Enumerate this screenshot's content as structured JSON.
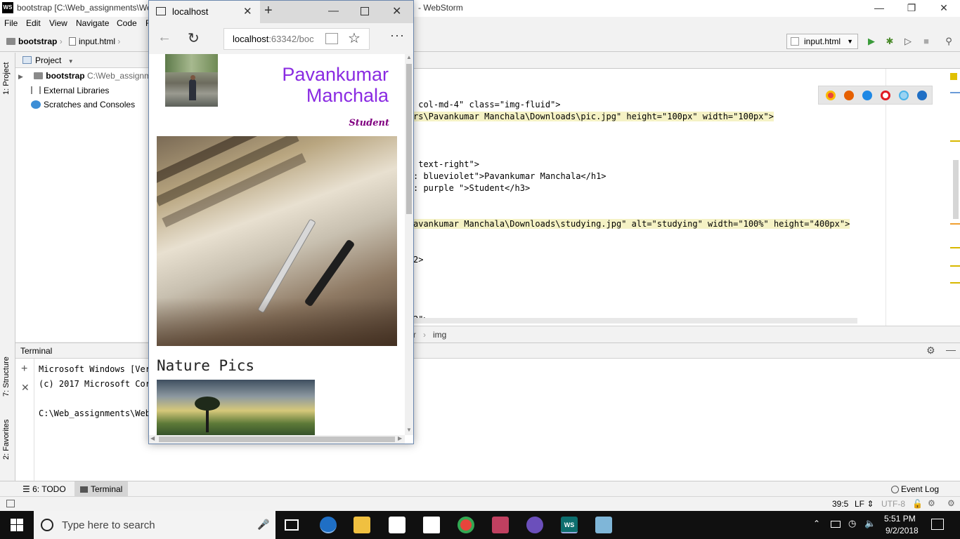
{
  "ide": {
    "title_left": "bootstrap [C:\\Web_assignments\\We",
    "title_right": "- WebStorm",
    "logo": "WS",
    "menu": [
      "File",
      "Edit",
      "View",
      "Navigate",
      "Code",
      "R"
    ],
    "breadcrumb": {
      "project": "bootstrap",
      "file": "input.html"
    },
    "run_config": "input.html",
    "left_tabs": {
      "project": "1: Project",
      "structure": "7: Structure",
      "favorites": "2: Favorites"
    },
    "project_panel": {
      "header": "Project",
      "items": [
        {
          "name": "bootstrap",
          "path": "C:\\Web_assignm"
        },
        {
          "name": "External Libraries"
        },
        {
          "name": "Scratches and Consoles"
        }
      ]
    },
    "editor_lines": [
      {
        "pre": "",
        "tagtext": "",
        "content": [
          {
            "t": "attr",
            "v": "col-md-4"
          },
          {
            "t": "str",
            "v": "\""
          },
          {
            "t": "attr",
            "v": " class="
          },
          {
            "t": "str",
            "v": "\"img-fluid\""
          },
          {
            "t": "tag",
            "v": ">"
          }
        ],
        "raw": " col-md-4\" class=\"img-fluid\">"
      },
      {
        "raw": "rs\\Pavankumar Manchala\\Downloads\\pic.jpg\" height=\"100px\" width=\"100px\">"
      },
      {
        "raw": " text-right\">"
      },
      {
        "raw": ": blueviolet\">Pavankumar Manchala</h1>"
      },
      {
        "raw": ": purple \">Student</h3>"
      },
      {
        "raw": "avankumar Manchala\\Downloads\\studying.jpg\" alt=\"studying\" width=\"100%\" height=\"400px\">"
      },
      {
        "raw": "2>"
      },
      {
        "raw": "2\">"
      }
    ],
    "editor_breadcrumb": {
      "left": "r",
      "right": "img"
    },
    "terminal": {
      "title": "Terminal",
      "lines": [
        "Microsoft Windows [Vers",
        "(c) 2017 Microsoft Corp",
        "",
        "C:\\Web_assignments\\Web_"
      ]
    },
    "bottom_tabs": {
      "todo": "6: TODO",
      "terminal": "Terminal",
      "event_log": "Event Log"
    },
    "status": {
      "position": "39:5",
      "line_sep": "LF",
      "encoding": "UTF-8"
    }
  },
  "browser": {
    "tab_title": "localhost",
    "address": "localhost",
    "address_rest": ":63342/boc",
    "page": {
      "name": "Pavankumar Manchala",
      "name_line1": "Pavankumar",
      "name_line2": "Manchala",
      "role": "Student",
      "section_heading": "Nature Pics"
    }
  },
  "taskbar": {
    "search_placeholder": "Type here to search",
    "time": "5:51 PM",
    "date": "9/2/2018"
  },
  "colors": {
    "name_color": "#8a2be2",
    "role_color": "#800080",
    "ide_accent": "#0000ff"
  }
}
